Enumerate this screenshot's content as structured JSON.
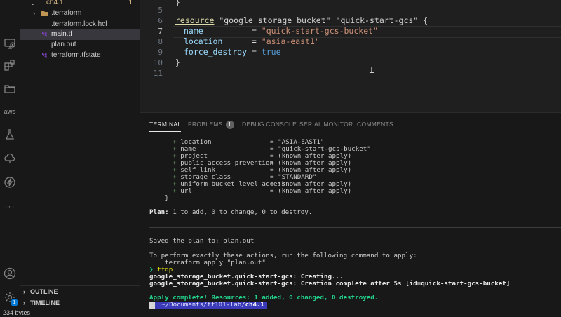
{
  "explorer": {
    "folder": {
      "name": "ch4.1",
      "count": "1"
    },
    "items": [
      {
        "label": ".terraform",
        "type": "folder"
      },
      {
        "label": ".terraform.lock.hcl",
        "type": "file"
      },
      {
        "label": "main.tf",
        "type": "terraform"
      },
      {
        "label": "plan.out",
        "type": "file"
      },
      {
        "label": "terraform.tfstate",
        "type": "terraform"
      }
    ],
    "outline_label": "OUTLINE",
    "timeline_label": "TIMELINE"
  },
  "activity_bar": {
    "aws_label": "aws",
    "accounts_badge": "1"
  },
  "editor": {
    "lines": [
      {
        "num": "5",
        "text": ""
      },
      {
        "num": "6",
        "resource_kw": "resource",
        "type": "\"google_storage_bucket\"",
        "name": "\"quick-start-gcs\"",
        "brace": " {"
      },
      {
        "num": "7",
        "prop": "name",
        "pad": "          = ",
        "value": "\"quick-start-gcs-bucket\""
      },
      {
        "num": "8",
        "prop": "location",
        "pad": "      = ",
        "value": "\"asia-east1\""
      },
      {
        "num": "9",
        "prop": "force_destroy",
        "pad": " = ",
        "value": "true"
      },
      {
        "num": "10",
        "text": "}"
      },
      {
        "num": "11",
        "text": ""
      }
    ]
  },
  "panel": {
    "tabs": [
      {
        "label": "TERMINAL",
        "active": true
      },
      {
        "label": "PROBLEMS",
        "count": "1"
      },
      {
        "label": "DEBUG CONSOLE"
      },
      {
        "label": "SERIAL MONITOR"
      },
      {
        "label": "COMMENTS"
      }
    ],
    "attributes": [
      {
        "key": "location",
        "value": "\"ASIA-EAST1\""
      },
      {
        "key": "name",
        "value": "\"quick-start-gcs-bucket\""
      },
      {
        "key": "project",
        "value": "(known after apply)"
      },
      {
        "key": "public_access_prevention",
        "value": "(known after apply)"
      },
      {
        "key": "self_link",
        "value": "(known after apply)"
      },
      {
        "key": "storage_class",
        "value": "\"STANDARD\""
      },
      {
        "key": "uniform_bucket_level_access",
        "value": "(known after apply)"
      },
      {
        "key": "url",
        "value": "(known after apply)"
      }
    ],
    "close_brace": "}",
    "plan_label": "Plan:",
    "plan_text": " 1 to add, 0 to change, 0 to destroy.",
    "saved_text": "Saved the plan to: plan.out",
    "perform_text": "To perform exactly these actions, run the following command to apply:",
    "apply_cmd": "terraform apply \"plan.out\"",
    "prompt_symbol": "❯",
    "command": "tfdp",
    "creating": "google_storage_bucket.quick-start-gcs: Creating...",
    "complete": "google_storage_bucket.quick-start-gcs: Creation complete after 5s [id=quick-start-gcs-bucket]",
    "apply_complete": "Apply complete! Resources: 1 added, 0 changed, 0 destroyed.",
    "prompt_seg1": "",
    "prompt_path_prefix": " ~/Documents/tf101-lab/",
    "prompt_path_bold": "ch4.1"
  },
  "status": {
    "size": "234 bytes"
  },
  "colors": {
    "background": "#1f1f1f",
    "panel": "#181818",
    "string": "#ce9178",
    "keyword": "#dcdcaa",
    "property": "#9cdcfe",
    "success": "#23d18b",
    "accent": "#0078d4"
  }
}
